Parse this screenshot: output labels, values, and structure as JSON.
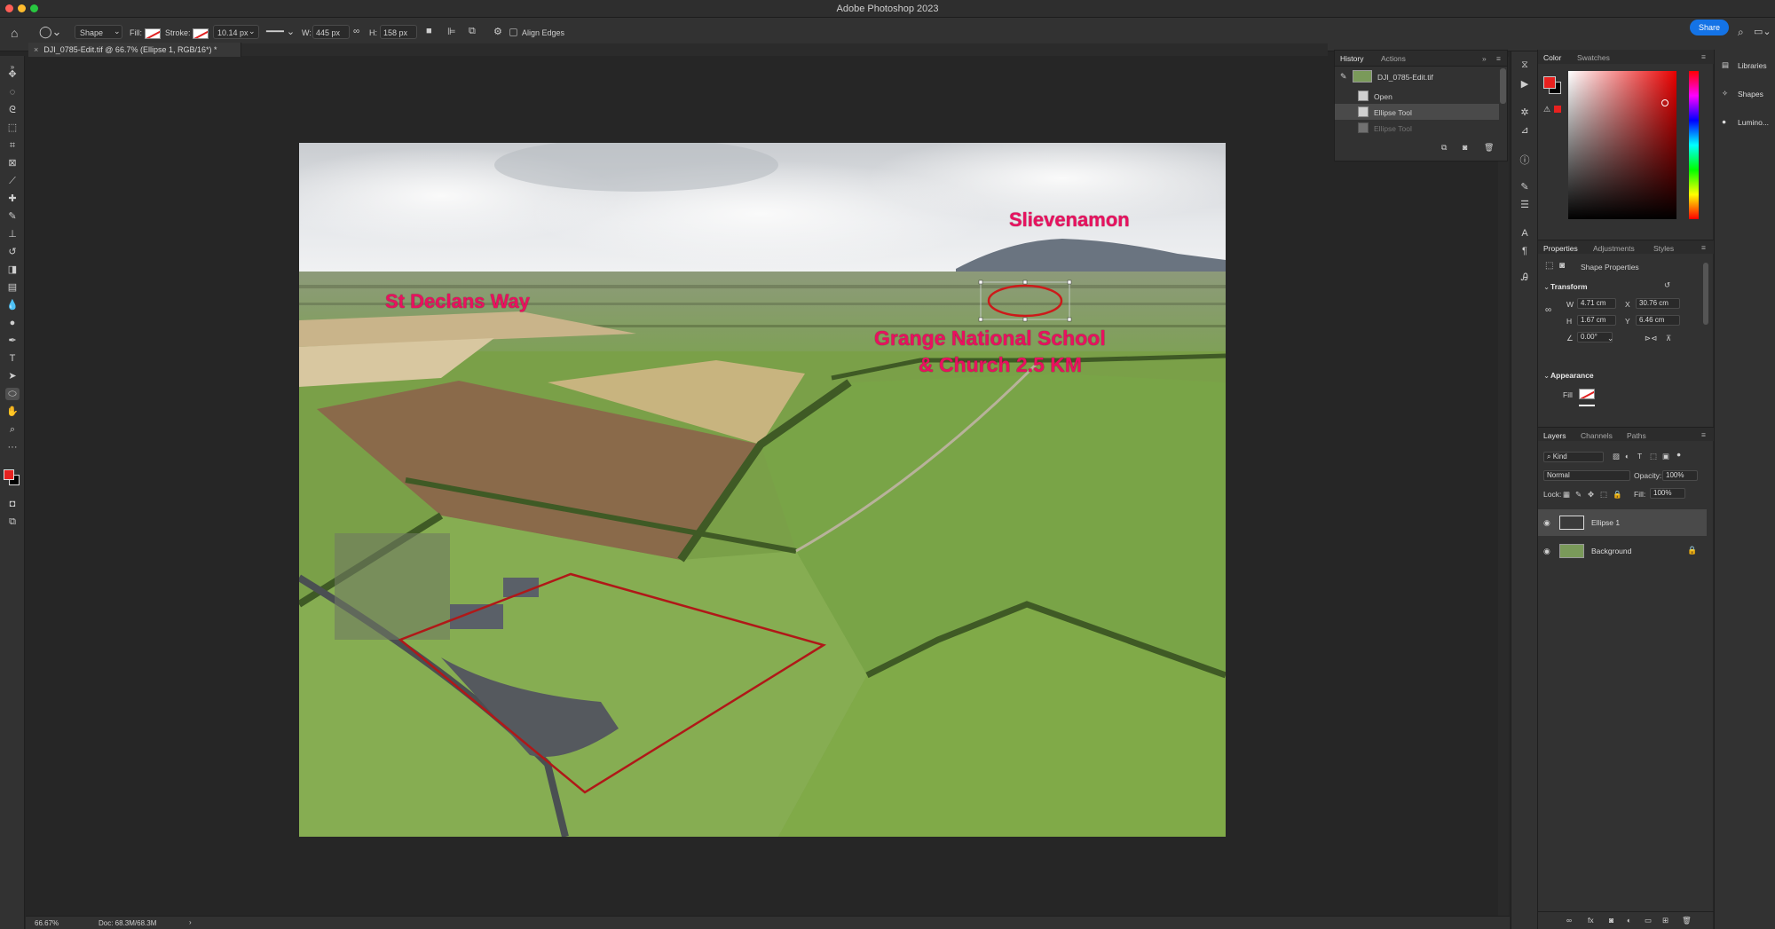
{
  "app": {
    "title": "Adobe Photoshop 2023",
    "share_label": "Share"
  },
  "options_bar": {
    "mode": "Shape",
    "fill_label": "Fill:",
    "stroke_label": "Stroke:",
    "stroke_width": "10.14 px",
    "w_label": "W:",
    "w_value": "445 px",
    "h_label": "H:",
    "h_value": "158 px",
    "align_edges": "Align Edges"
  },
  "document": {
    "tab_title": "DJI_0785-Edit.tif @ 66.7% (Ellipse 1, RGB/16*) *",
    "zoom": "66.67%",
    "doc_size": "Doc: 68.3M/68.3M"
  },
  "photo_labels": {
    "slievenamon": "Slievenamon",
    "st_declans": "St Declans Way",
    "grange_line1": "Grange National School",
    "grange_line2": "& Church 2.5 KM"
  },
  "history": {
    "tabs": [
      "History",
      "Actions"
    ],
    "snapshot": "DJI_0785-Edit.tif",
    "items": [
      "Open",
      "Ellipse Tool",
      "Ellipse Tool"
    ]
  },
  "color_panel": {
    "tabs": [
      "Color",
      "Swatches"
    ],
    "foreground": "#e8211f",
    "background": "#000000"
  },
  "properties": {
    "tabs": [
      "Properties",
      "Adjustments",
      "Styles"
    ],
    "subtitle": "Shape Properties",
    "transform_label": "Transform",
    "w_label": "W",
    "w": "4.71 cm",
    "x_label": "X",
    "x": "30.76 cm",
    "h_label": "H",
    "h": "1.67 cm",
    "y_label": "Y",
    "y": "6.46 cm",
    "angle": "0.00°",
    "appearance_label": "Appearance",
    "fill_label": "Fill"
  },
  "layers": {
    "tabs": [
      "Layers",
      "Channels",
      "Paths"
    ],
    "kind": "Kind",
    "blend_mode": "Normal",
    "opacity_label": "Opacity:",
    "opacity": "100%",
    "lock_label": "Lock:",
    "fill_label": "Fill:",
    "fill": "100%",
    "items": [
      "Ellipse 1",
      "Background"
    ]
  },
  "libraries": {
    "items": [
      "Libraries",
      "Shapes",
      "Lumino..."
    ]
  },
  "colors": {
    "accent_blue": "#1473e6",
    "label_pink": "#e8115f",
    "annotation_red": "#b01818"
  }
}
